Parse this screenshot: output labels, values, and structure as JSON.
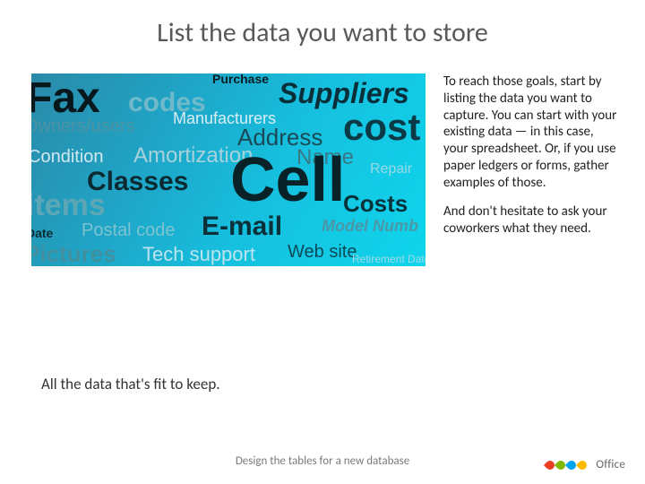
{
  "title": "List the data you want to store",
  "body": {
    "p1": "To reach those goals, start by listing the data you want to capture. You can start with your existing data — in this case, your spreadsheet. Or, if you use paper ledgers or forms, gather examples of those.",
    "p2": "And don't hesitate to ask your coworkers what they need."
  },
  "caption": "All the data that's fit to keep.",
  "footer": "Design the tables for a new database",
  "logo_text": "Office",
  "wordcloud": {
    "fax": "Fax",
    "codes": "codes",
    "purchase": "Purchase",
    "suppliers": "Suppliers",
    "owners": "Owners/users",
    "manufacturers": "Manufacturers",
    "address": "Address",
    "cost": "cost",
    "condition": "Condition",
    "amortization": "Amortization",
    "name": "Name",
    "classes": "Classes",
    "cell": "Cell",
    "repair": "Repair",
    "items": "items",
    "costs": "Costs",
    "date": "Date",
    "postal": "Postal code",
    "email": "E-mail",
    "modelnum": "Model Numb",
    "pictures": "Pictures",
    "techsupport": "Tech support",
    "website": "Web site",
    "retirement": "Retirement Date"
  }
}
